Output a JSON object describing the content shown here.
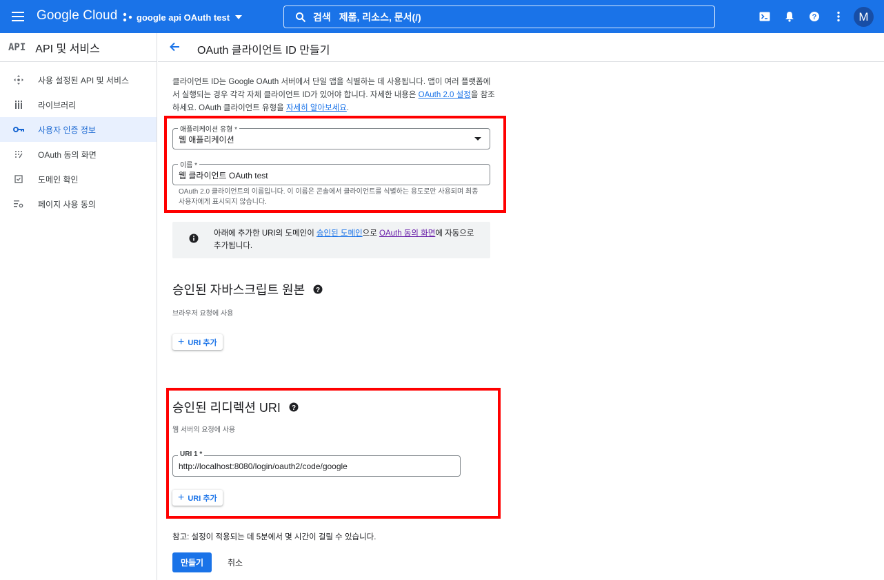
{
  "topbar": {
    "logo": "Google Cloud",
    "project": "google api OAuth test",
    "search_label": "검색",
    "search_placeholder": "제품, 리소스, 문서(/)",
    "avatar_letter": "M",
    "icons": [
      "menu-icon",
      "project-icon",
      "search-icon",
      "cloud-shell-icon",
      "notifications-icon",
      "help-icon",
      "more-vert-icon"
    ]
  },
  "sidebar": {
    "badge": "API",
    "title": "API 및 서비스",
    "items": [
      {
        "label": "사용 설정된 API 및 서비스",
        "icon": "enabled-apis-icon"
      },
      {
        "label": "라이브러리",
        "icon": "library-icon"
      },
      {
        "label": "사용자 인증 정보",
        "icon": "key-icon",
        "active": true
      },
      {
        "label": "OAuth 동의 화면",
        "icon": "consent-screen-icon"
      },
      {
        "label": "도메인 확인",
        "icon": "domain-verify-icon"
      },
      {
        "label": "페이지 사용 동의",
        "icon": "page-usage-icon"
      }
    ]
  },
  "page": {
    "title": "OAuth 클라이언트 ID 만들기",
    "intro_1": "클라이언트 ID는 Google OAuth 서버에서 단일 앱을 식별하는 데 사용됩니다. 앱이 여러 플랫폼에서 실행되는 경우 각각 자체 클라이언트 ID가 있어야 합니다. 자세한 내용은 ",
    "intro_link_1": "OAuth 2.0 설정",
    "intro_2": "을 참조하세요. OAuth 클라이언트 유형을 ",
    "intro_link_2": "자세히 알아보세요",
    "intro_3": ".",
    "app_type_label": "애플리케이션 유형 *",
    "app_type_value": "웹 애플리케이션",
    "name_label": "이름 *",
    "name_value": "웹 클라이언트 OAuth test",
    "name_hint": "OAuth 2.0 클라이언트의 이름입니다. 이 이름은 콘솔에서 클라이언트를 식별하는 용도로만 사용되며 최종 사용자에게 표시되지 않습니다.",
    "info_1": "아래에 추가한 URI의 도메인이 ",
    "info_link_1": "승인된 도메인",
    "info_2": "으로 ",
    "info_link_2": "OAuth 동의 화면",
    "info_3": "에 자동으로 추가됩니다.",
    "origins_title": "승인된 자바스크립트 원본",
    "origins_sub": "브라우저 요청에 사용",
    "add_uri": "URI 추가",
    "redirect_title": "승인된 리디렉션 URI",
    "redirect_sub": "웹 서버의 요청에 사용",
    "uri1_label": "URI 1 *",
    "uri1_value": "http://localhost:8080/login/oauth2/code/google",
    "note": "참고: 설정이 적용되는 데 5분에서 몇 시간이 걸릴 수 있습니다.",
    "create": "만들기",
    "cancel": "취소"
  },
  "colors": {
    "brand": "#1a73e8",
    "highlight_box": "#ff0000",
    "active_nav_bg": "#e8f0fe"
  }
}
